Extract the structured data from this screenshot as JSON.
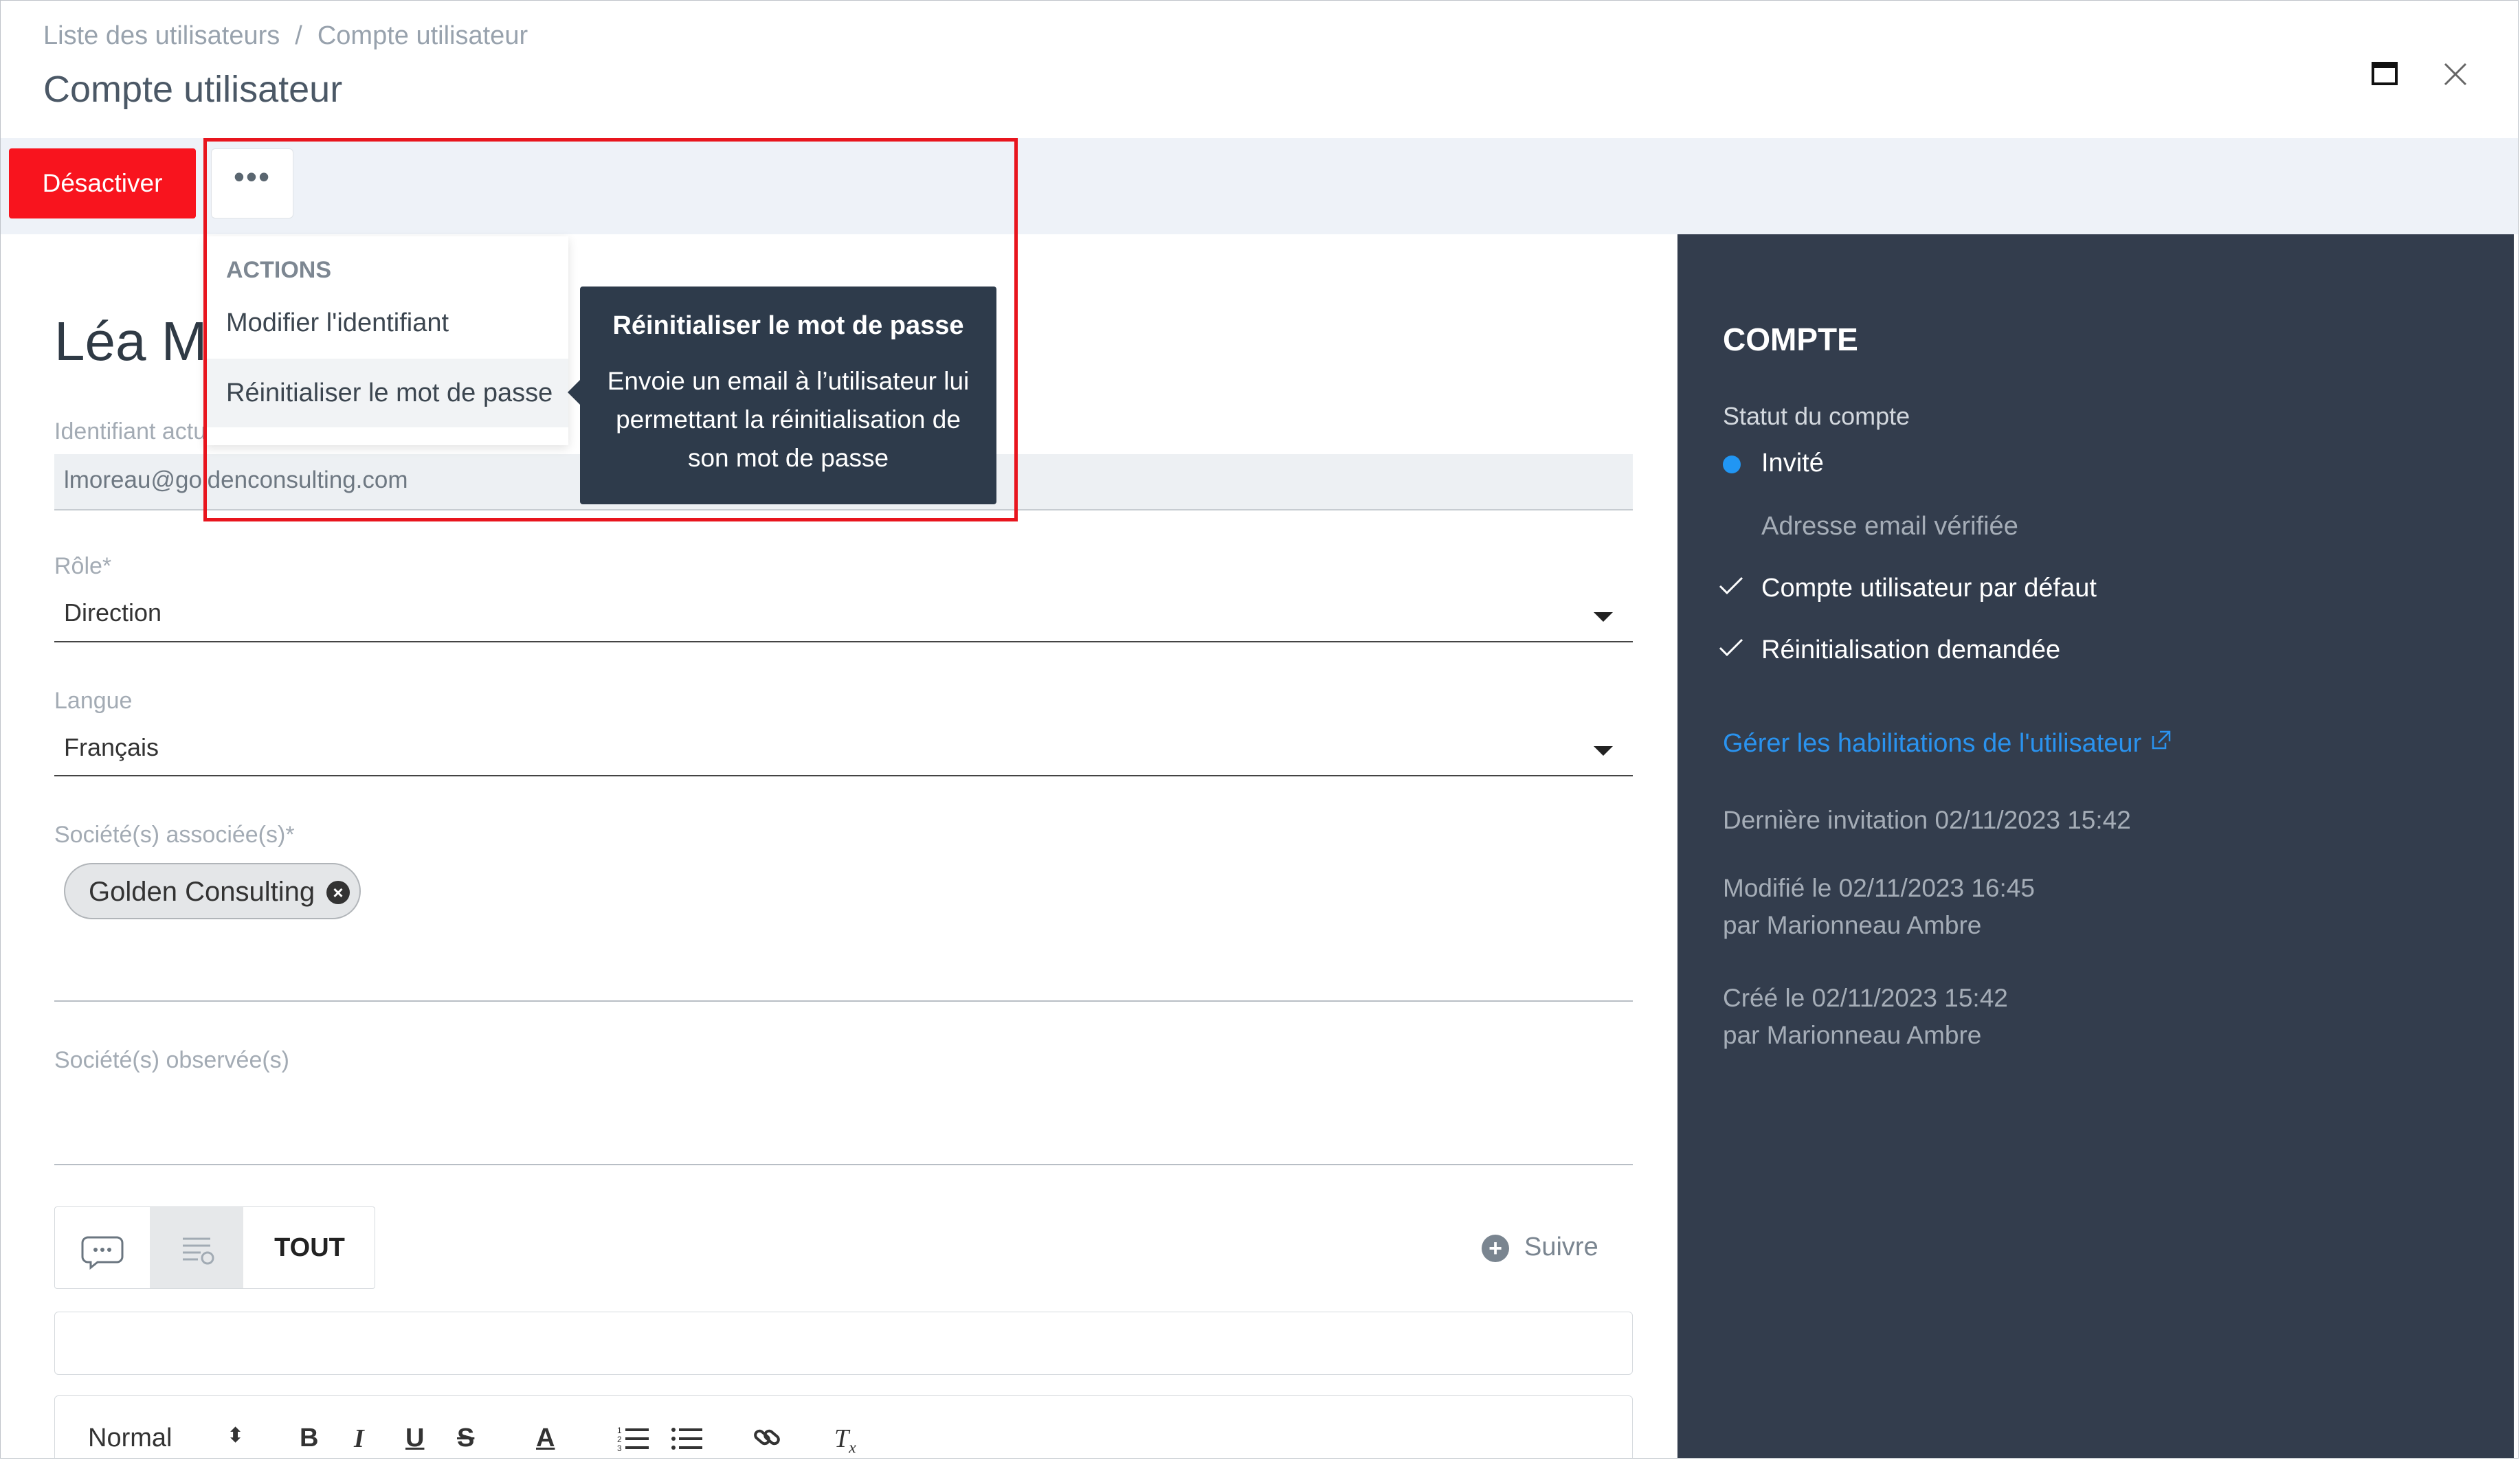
{
  "header": {
    "breadcrumb": [
      "Liste des utilisateurs",
      "Compte utilisateur"
    ],
    "breadcrumb_sep": "/",
    "title": "Compte utilisateur"
  },
  "toolbar": {
    "deactivate_label": "Désactiver",
    "more_label": "•••"
  },
  "menu": {
    "header": "ACTIONS",
    "items": [
      "Modifier l'identifiant",
      "Réinitialiser le mot de passe"
    ]
  },
  "tooltip": {
    "title": "Réinitialiser le mot de passe",
    "body": "Envoie un email à l’utilisateur lui permettant la réinitialisation de son mot de passe"
  },
  "form": {
    "user_name": "Léa M",
    "identifier_label": "Identifiant actuel",
    "identifier_value": "lmoreau@goldenconsulting.com",
    "role_label": "Rôle*",
    "role_value": "Direction",
    "language_label": "Langue",
    "language_value": "Français",
    "companies_label": "Société(s) associée(s)*",
    "company_chip": "Golden Consulting",
    "observed_label": "Société(s) observée(s)"
  },
  "comments": {
    "tab_all": "TOUT",
    "follow_label": "Suivre",
    "editor_style": "Normal"
  },
  "side": {
    "title": "COMPTE",
    "status_label": "Statut du compte",
    "status_value": "Invité",
    "email_verified": "Adresse email vérifiée",
    "default_account": "Compte utilisateur par défaut",
    "reset_requested": "Réinitialisation demandée",
    "manage_link": "Gérer les habilitations de l'utilisateur",
    "last_invite": "Dernière invitation   02/11/2023 15:42",
    "modified": "Modifié le   02/11/2023 16:45",
    "modified_by": "par Marionneau Ambre",
    "created": "Créé le   02/11/2023 15:42",
    "created_by": "par Marionneau Ambre"
  },
  "colors": {
    "danger": "#f8141e",
    "panel": "#333d4d",
    "link": "#2a93ef",
    "status_dot": "#2196f3",
    "annotation": "#e8151e"
  }
}
